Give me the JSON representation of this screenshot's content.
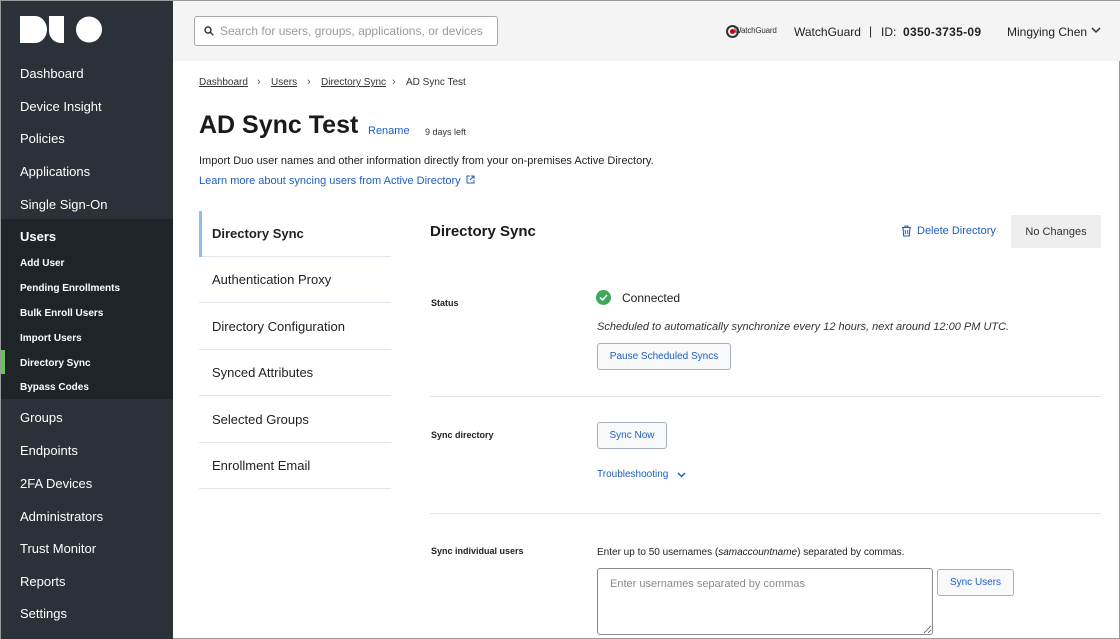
{
  "brand": {
    "logo_text": "DUO",
    "sidebar_bg": "#2b3138",
    "active_accent": "#6ac259",
    "link_color": "#1f5dc5"
  },
  "sidebar": {
    "items": [
      {
        "label": "Dashboard"
      },
      {
        "label": "Device Insight"
      },
      {
        "label": "Policies"
      },
      {
        "label": "Applications"
      },
      {
        "label": "Single Sign-On"
      },
      {
        "label": "Users"
      },
      {
        "label": "Groups"
      },
      {
        "label": "Endpoints"
      },
      {
        "label": "2FA Devices"
      },
      {
        "label": "Administrators"
      },
      {
        "label": "Trust Monitor"
      },
      {
        "label": "Reports"
      },
      {
        "label": "Settings"
      }
    ],
    "users_subitems": [
      {
        "label": "Add User"
      },
      {
        "label": "Pending Enrollments"
      },
      {
        "label": "Bulk Enroll Users"
      },
      {
        "label": "Import Users"
      },
      {
        "label": "Directory Sync"
      },
      {
        "label": "Bypass Codes"
      }
    ]
  },
  "topbar": {
    "search_placeholder": "Search for users, groups, applications, or devices",
    "partner_logo_text": "WatchGuard",
    "org_name": "WatchGuard",
    "separator": "|",
    "id_label": "ID:",
    "id_value": "0350-3735-09",
    "user_name": "Mingying Chen"
  },
  "breadcrumb": {
    "items": [
      "Dashboard",
      "Users",
      "Directory Sync"
    ],
    "current": "AD Sync Test"
  },
  "page": {
    "title": "AD Sync Test",
    "rename_label": "Rename",
    "days_left": "9 days left",
    "intro": "Import Duo user names and other information directly from your on-premises Active Directory.",
    "learn_more": "Learn more about syncing users from Active Directory"
  },
  "tabs": [
    {
      "label": "Directory Sync",
      "active": true
    },
    {
      "label": "Authentication Proxy"
    },
    {
      "label": "Directory Configuration"
    },
    {
      "label": "Synced Attributes"
    },
    {
      "label": "Selected Groups"
    },
    {
      "label": "Enrollment Email"
    }
  ],
  "panel": {
    "title": "Directory Sync",
    "delete_label": "Delete Directory",
    "no_changes_label": "No Changes",
    "status": {
      "label": "Status",
      "value": "Connected",
      "schedule_text": "Scheduled to automatically synchronize every 12 hours, next around 12:00 PM UTC.",
      "pause_button": "Pause Scheduled Syncs"
    },
    "sync_directory": {
      "label": "Sync directory",
      "button": "Sync Now",
      "troubleshooting": "Troubleshooting"
    },
    "sync_users": {
      "label": "Sync individual users",
      "hint_prefix": "Enter up to 50 usernames (",
      "hint_term": "samaccountname",
      "hint_suffix": ") separated by commas.",
      "placeholder": "Enter usernames separated by commas",
      "button": "Sync Users"
    }
  }
}
